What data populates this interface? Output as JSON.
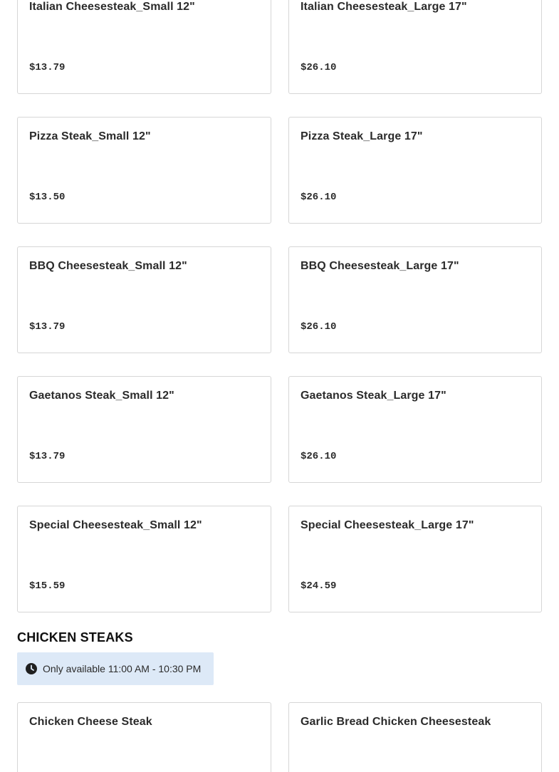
{
  "menu_section_1": {
    "items": [
      {
        "name": "Italian Cheesesteak_Small 12\"",
        "price": "$13.79"
      },
      {
        "name": "Italian Cheesesteak_Large 17\"",
        "price": "$26.10"
      },
      {
        "name": "Pizza Steak_Small 12\"",
        "price": "$13.50"
      },
      {
        "name": "Pizza Steak_Large 17\"",
        "price": "$26.10"
      },
      {
        "name": "BBQ Cheesesteak_Small 12\"",
        "price": "$13.79"
      },
      {
        "name": "BBQ Cheesesteak_Large 17\"",
        "price": "$26.10"
      },
      {
        "name": "Gaetanos Steak_Small 12\"",
        "price": "$13.79"
      },
      {
        "name": "Gaetanos Steak_Large 17\"",
        "price": "$26.10"
      },
      {
        "name": "Special Cheesesteak_Small 12\"",
        "price": "$15.59"
      },
      {
        "name": "Special Cheesesteak_Large 17\"",
        "price": "$24.59"
      }
    ]
  },
  "chicken_steaks": {
    "title": "CHICKEN STEAKS",
    "availability": "Only available 11:00 AM - 10:30 PM",
    "icon": "clock-icon",
    "items": [
      {
        "name": "Chicken Cheese Steak"
      },
      {
        "name": "Garlic Bread Chicken Cheesesteak"
      }
    ]
  }
}
